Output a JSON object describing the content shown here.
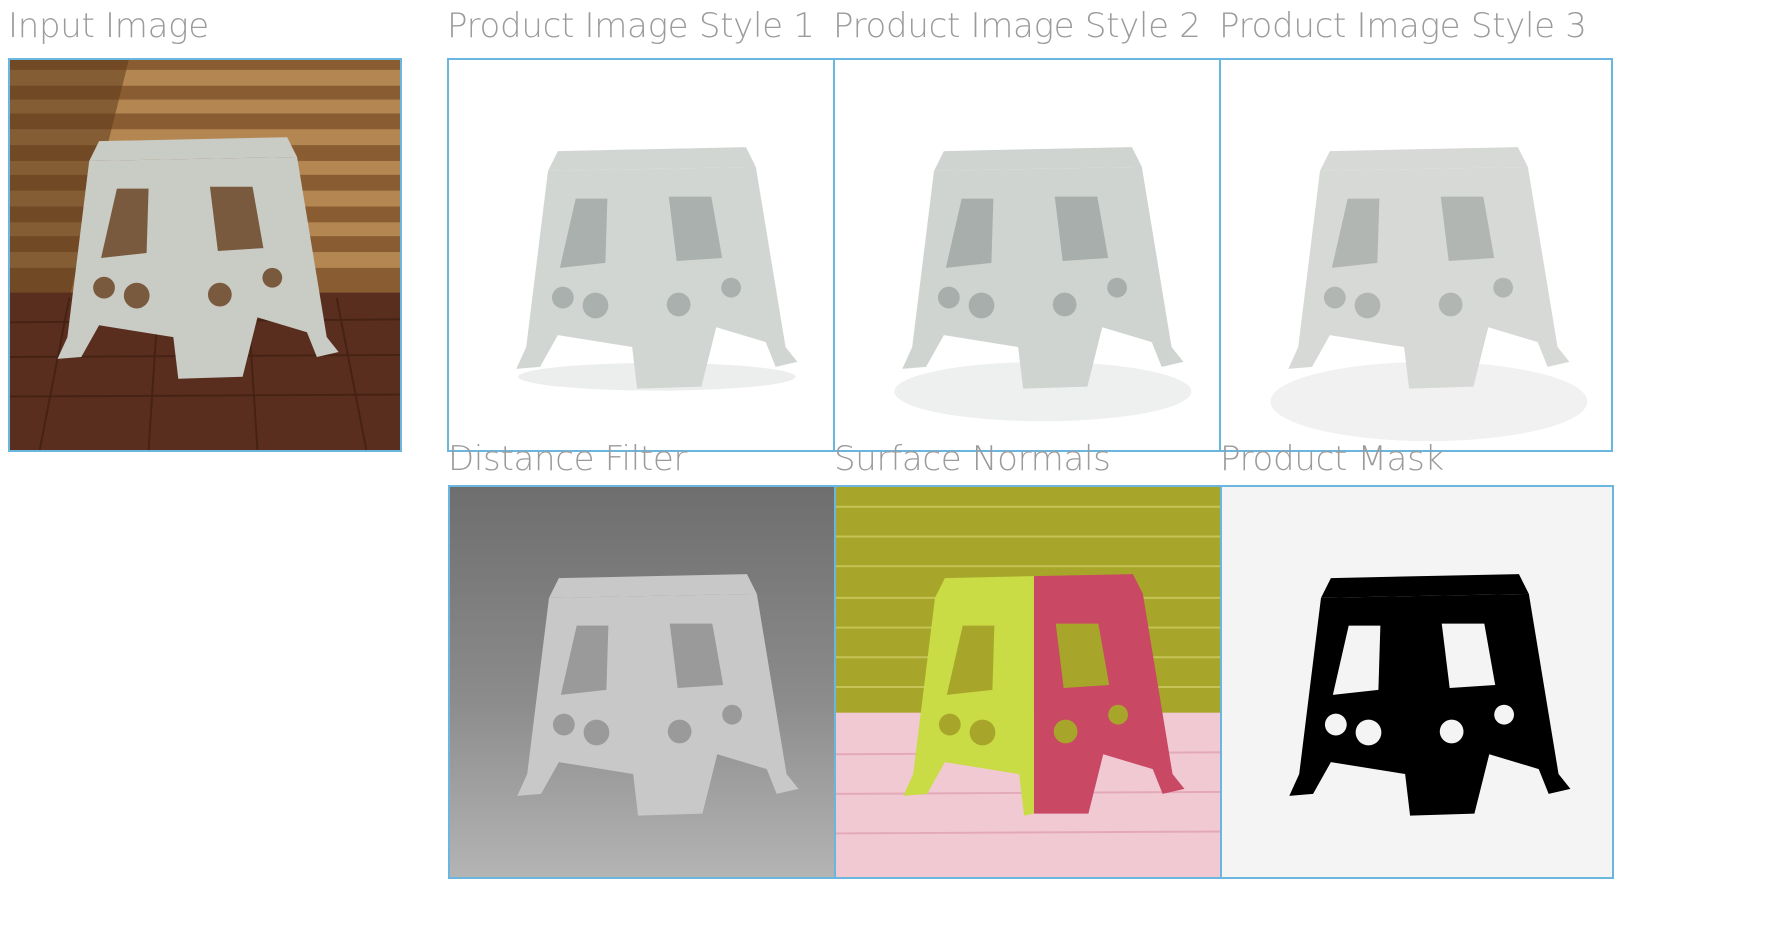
{
  "panels": {
    "input": {
      "label": "Input Image"
    },
    "style1": {
      "label": "Product Image Style 1"
    },
    "style2": {
      "label": "Product Image Style 2"
    },
    "style3": {
      "label": "Product Image Style 3"
    },
    "distance": {
      "label": "Distance Filter"
    },
    "normals": {
      "label": "Surface Normals"
    },
    "mask": {
      "label": "Product Mask"
    }
  },
  "colors": {
    "label": "#9b9b9b",
    "frame_border": "#6bb6de",
    "stool_gray": "#d4d7d4",
    "wood_wall": "#a67a45",
    "brick_floor": "#6b3a26",
    "normals_wall": "#a8a62a",
    "normals_floor": "#f1c9d3",
    "normals_left": "#c9dc45",
    "normals_right": "#c94864",
    "mask_black": "#000000"
  }
}
